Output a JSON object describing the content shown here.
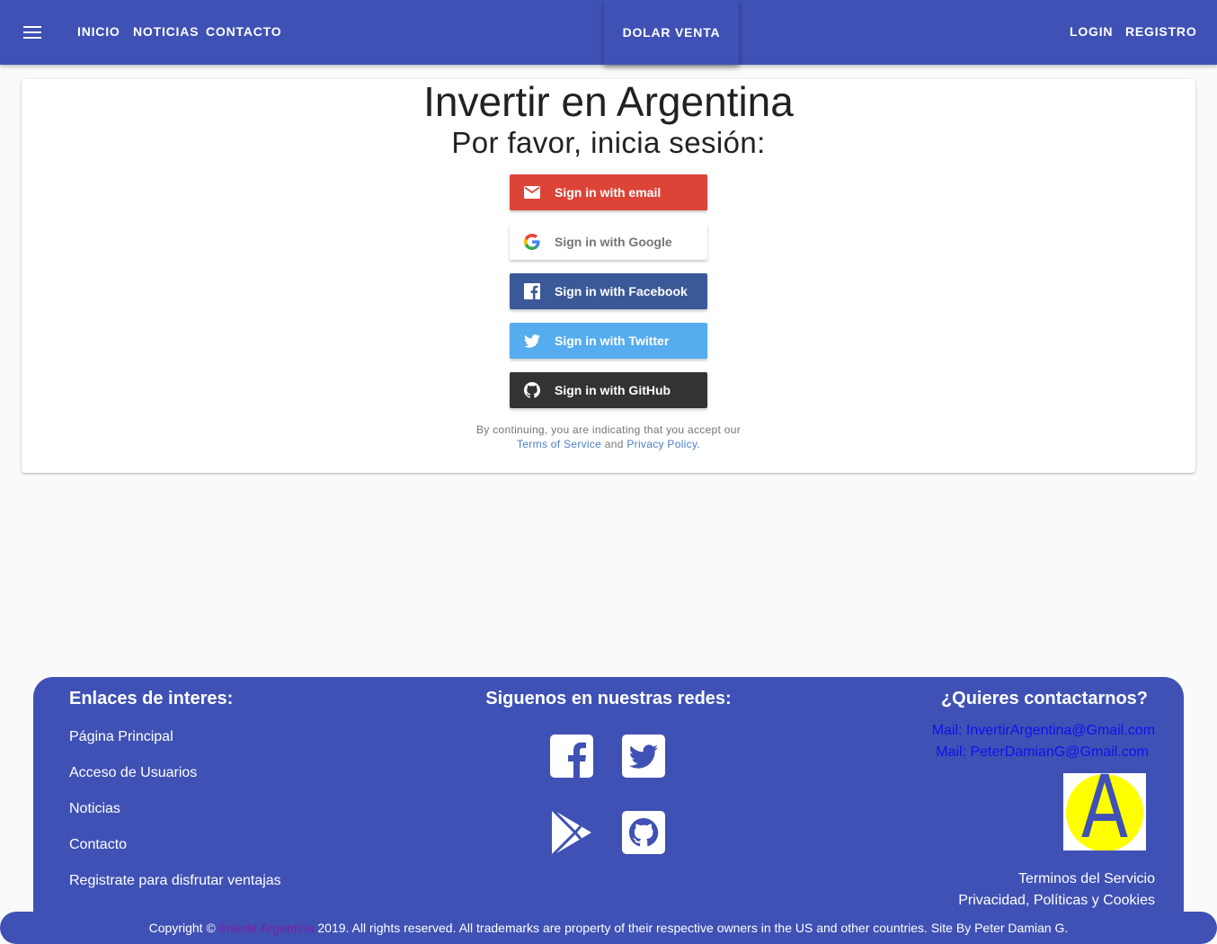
{
  "nav": {
    "menu_icon": "hamburger-menu-icon",
    "links": [
      "INICIO",
      "NOTICIAS",
      "CONTACTO"
    ],
    "center_button": "DOLAR VENTA",
    "right_links": [
      "LOGIN",
      "REGISTRO"
    ]
  },
  "card": {
    "title": "Invertir en Argentina",
    "subtitle": "Por favor, inicia sesión:",
    "providers": [
      {
        "label": "Sign in with email",
        "icon": "email-icon",
        "color": "#db4437"
      },
      {
        "label": "Sign in with Google",
        "icon": "google-icon",
        "color": "#ffffff"
      },
      {
        "label": "Sign in with Facebook",
        "icon": "facebook-icon",
        "color": "#3b5998"
      },
      {
        "label": "Sign in with Twitter",
        "icon": "twitter-icon",
        "color": "#55acee"
      },
      {
        "label": "Sign in with GitHub",
        "icon": "github-icon",
        "color": "#333333"
      }
    ],
    "tos_prefix": "By continuing, you are indicating that you accept our",
    "tos_link": "Terms of Service",
    "tos_and": "and",
    "privacy_link": "Privacy Policy",
    "tos_suffix": "."
  },
  "footer": {
    "links_heading": "Enlaces de interes:",
    "links": [
      "Página Principal",
      "Acceso de Usuarios",
      "Noticias",
      "Contacto",
      "Registrate para disfrutar ventajas"
    ],
    "social_heading": "Siguenos en nuestras redes:",
    "social_icons": [
      "facebook-icon",
      "twitter-icon",
      "google-play-icon",
      "github-icon"
    ],
    "contact_heading": "¿Quieres contactarnos?",
    "mails": [
      "Mail: InvertirArgentina@Gmail.com",
      "Mail: PeterDamianG@Gmail.com"
    ],
    "logo_letter": "A",
    "terms": "Terminos del Servicio",
    "privacy": "Privacidad, Políticas y Cookies"
  },
  "copyright": {
    "prefix": "Copyright ©",
    "brand": "Invertir Argentina",
    "suffix": "2019. All rights reserved. All trademarks are property of their respective owners in the US and other countries. Site By Peter Damian G."
  },
  "colors": {
    "primary": "#3f51b5",
    "background": "#fafafa",
    "mail_link": "#1010ee",
    "brand_link": "#7b1fa2",
    "logo_sun": "#ffff00"
  }
}
